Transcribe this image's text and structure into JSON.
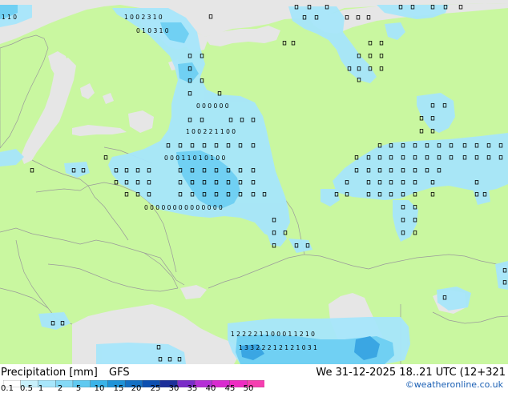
{
  "map": {
    "colors": {
      "sea": "#e6e6e6",
      "land": "#c9f7a0",
      "borders": "#9a9a9a",
      "precip_light": "#a7e6fb",
      "precip_medium": "#70d0f3",
      "precip_heavy": "#3aa6e3",
      "label_text": "#000000"
    },
    "label_rows": [
      {
        "text": "1 1 0",
        "bind_key": "r0"
      },
      {
        "text": "1 0 0 2 3 1 0",
        "bind_key": "r1"
      },
      {
        "text": "0 1 0 3 1 0",
        "bind_key": "r2"
      },
      {
        "text": "0 0 0 0 0 0",
        "bind_key": "r3"
      },
      {
        "text": "1 0 0 2 2 1 1 0 0",
        "bind_key": "r4"
      },
      {
        "text": "0 0 0 1 1 0 1 0 1 0 0",
        "bind_key": "r5"
      },
      {
        "text": "0 0 0 0 0 0 0 0 0 0 0 0 0 0",
        "bind_key": "r6"
      },
      {
        "text": "1 2 2 2 2 1 1 0 0 0 1 1 2 1 0",
        "bind_key": "r7"
      },
      {
        "text": "1 3 3 2 2 2 1 2 1 2 1 0 3 1",
        "bind_key": "r8"
      }
    ]
  },
  "footer": {
    "title": "Precipitation [mm]",
    "model": "GFS",
    "valid_time": "We 31-12-2025 18..21 UTC (12+321",
    "credit": "©weatheronline.co.uk"
  },
  "legend": {
    "ticks": [
      "0.1",
      "0.5",
      "1",
      "2",
      "5",
      "10",
      "15",
      "20",
      "25",
      "30",
      "35",
      "40",
      "45",
      "50"
    ],
    "colors": [
      "#ffffff",
      "#c8f0fb",
      "#a7e6fb",
      "#84d9f6",
      "#5fc9f0",
      "#3ab3e8",
      "#1f93d8",
      "#1370c4",
      "#0c4fb0",
      "#1c2f9a",
      "#7a2cc8",
      "#b530d6",
      "#d92ad0",
      "#ee2cc2",
      "#f53fb0"
    ]
  }
}
